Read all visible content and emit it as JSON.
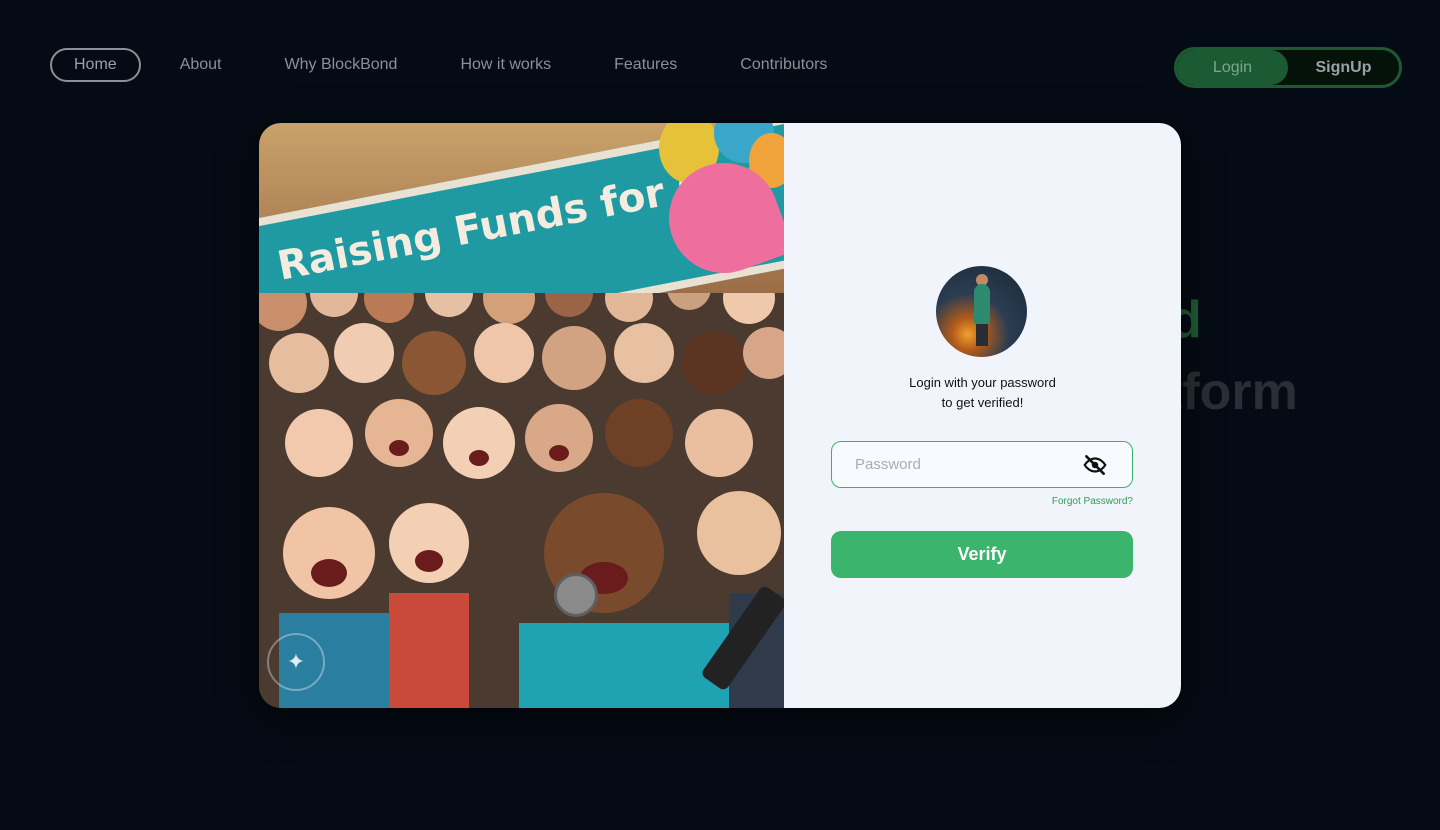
{
  "nav": {
    "links": [
      {
        "label": "Home"
      },
      {
        "label": "About"
      },
      {
        "label": "Why BlockBond"
      },
      {
        "label": "How it works"
      },
      {
        "label": "Features"
      },
      {
        "label": "Contributors"
      }
    ],
    "login_label": "Login",
    "signup_label": "SignUp"
  },
  "hero": {
    "fragment_green": "d",
    "fragment_gray": "tform"
  },
  "modal": {
    "banner_text": "Raising Funds for Cause",
    "prompt_line1": "Login with your password",
    "prompt_line2": "to get verified!",
    "password_placeholder": "Password",
    "forgot_label": "Forgot Password?",
    "verify_label": "Verify"
  },
  "colors": {
    "background": "#050b14",
    "accent_green": "#3bb46e",
    "panel": "#f1f5fb"
  },
  "icons": {
    "eye": "eye-slash-icon"
  }
}
